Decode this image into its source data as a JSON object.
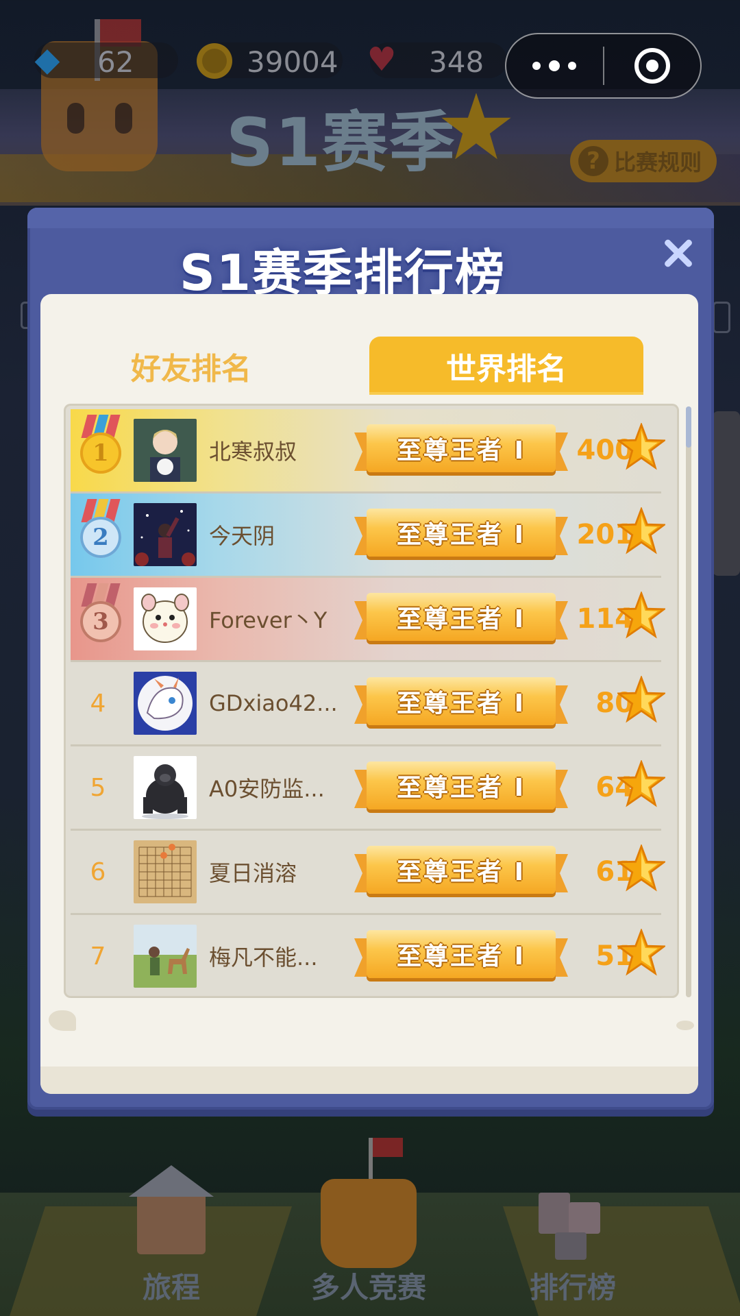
{
  "hud": {
    "gems": "62",
    "coins": "39004",
    "hearts": "348"
  },
  "season": {
    "title": "S1赛季",
    "rules_label": "比赛规则"
  },
  "modal": {
    "title": "S1赛季排行榜",
    "tabs": [
      {
        "label": "好友排名",
        "active": false
      },
      {
        "label": "世界排名",
        "active": true
      }
    ],
    "rows": [
      {
        "rank": "1",
        "name": "北寒叔叔",
        "tier": "至尊王者 Ⅰ",
        "score": "400"
      },
      {
        "rank": "2",
        "name": "今天阴",
        "tier": "至尊王者 Ⅰ",
        "score": "201"
      },
      {
        "rank": "3",
        "name": "Forever丶Y",
        "tier": "至尊王者 Ⅰ",
        "score": "114"
      },
      {
        "rank": "4",
        "name": "GDxiao42...",
        "tier": "至尊王者 Ⅰ",
        "score": "80"
      },
      {
        "rank": "5",
        "name": "A0安防监...",
        "tier": "至尊王者 Ⅰ",
        "score": "64"
      },
      {
        "rank": "6",
        "name": "夏日消溶",
        "tier": "至尊王者 Ⅰ",
        "score": "61"
      },
      {
        "rank": "7",
        "name": "梅凡不能...",
        "tier": "至尊王者 Ⅰ",
        "score": "51"
      }
    ]
  },
  "bottom_nav": [
    {
      "label": "旅程",
      "icon": "house-icon"
    },
    {
      "label": "多人竞赛",
      "icon": "castle-icon"
    },
    {
      "label": "排行榜",
      "icon": "blocks-icon"
    }
  ],
  "colors": {
    "modal_bg": "#4d5b9f",
    "active_tab": "#f6bb2a",
    "score": "#f5a118",
    "gold_medal": "#f8d94a",
    "silver_medal": "#76c8ec",
    "bronze_medal": "#e8968b"
  }
}
